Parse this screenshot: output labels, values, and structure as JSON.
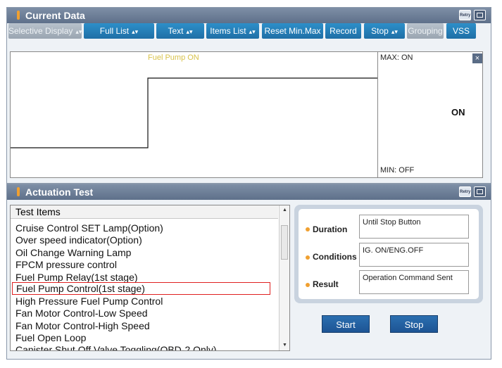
{
  "current_data": {
    "title": "Current Data",
    "retry_label": "Retry",
    "toolbar": {
      "selective_display": "Selective Display",
      "full_list": "Full List",
      "text": "Text",
      "items_list": "Items List",
      "reset_minmax": "Reset Min.Max",
      "record": "Record",
      "stop": "Stop",
      "grouping": "Grouping",
      "vss": "VSS"
    },
    "graph": {
      "signal_name": "Fuel Pump ON",
      "max_label": "MAX: ON",
      "min_label": "MIN: OFF",
      "current_value": "ON",
      "close_symbol": "×",
      "line_color": "#111111",
      "signal_color": "#d8c24a"
    }
  },
  "actuation_test": {
    "title": "Actuation Test",
    "retry_label": "Retry",
    "list_header": "Test Items",
    "items": [
      "Cruise Control SET Lamp(Option)",
      "Over speed indicator(Option)",
      "Oil Change Warning Lamp",
      "FPCM pressure control",
      "Fuel Pump Relay(1st stage)",
      "Fuel Pump Control(1st stage)",
      "High Pressure Fuel Pump Control",
      "Fan Motor Control-Low Speed",
      "Fan Motor Control-High Speed",
      "Fuel Open Loop",
      "Canister Shut Off Valve Toggling(OBD-2 Only)"
    ],
    "selected_index": 5,
    "details": {
      "duration_label": "Duration",
      "duration_value": "Until Stop Button",
      "conditions_label": "Conditions",
      "conditions_value": "IG. ON/ENG.OFF",
      "result_label": "Result",
      "result_value": "Operation Command Sent"
    },
    "start_label": "Start",
    "stop_label": "Stop"
  },
  "colors": {
    "accent_blue": "#1f6fa6",
    "title_bar": "#6b7d96",
    "marker_orange": "#f0a030",
    "selection_red": "#e02020"
  }
}
